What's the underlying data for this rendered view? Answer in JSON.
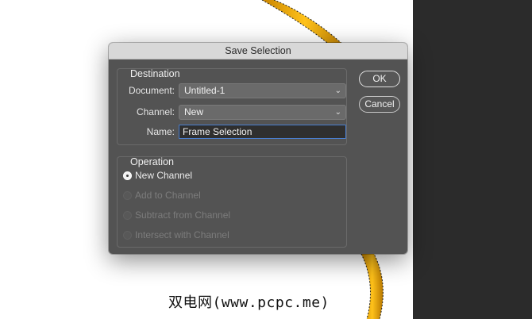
{
  "dialog": {
    "title": "Save Selection",
    "destination": {
      "group_label": "Destination",
      "document_label": "Document:",
      "document_value": "Untitled-1",
      "channel_label": "Channel:",
      "channel_value": "New",
      "name_label": "Name:",
      "name_value": "Frame Selection"
    },
    "operation": {
      "group_label": "Operation",
      "options": [
        {
          "label": "New Channel",
          "selected": true,
          "enabled": true
        },
        {
          "label": "Add to Channel",
          "selected": false,
          "enabled": false
        },
        {
          "label": "Subtract from Channel",
          "selected": false,
          "enabled": false
        },
        {
          "label": "Intersect with Channel",
          "selected": false,
          "enabled": false
        }
      ]
    },
    "buttons": {
      "ok_label": "OK",
      "cancel_label": "Cancel"
    }
  },
  "watermark": "双电网(www.pcpc.me)",
  "colors": {
    "frame_gold": "#f0a800",
    "dialog_bg": "#535353",
    "dark_panel": "#2b2b2b"
  }
}
